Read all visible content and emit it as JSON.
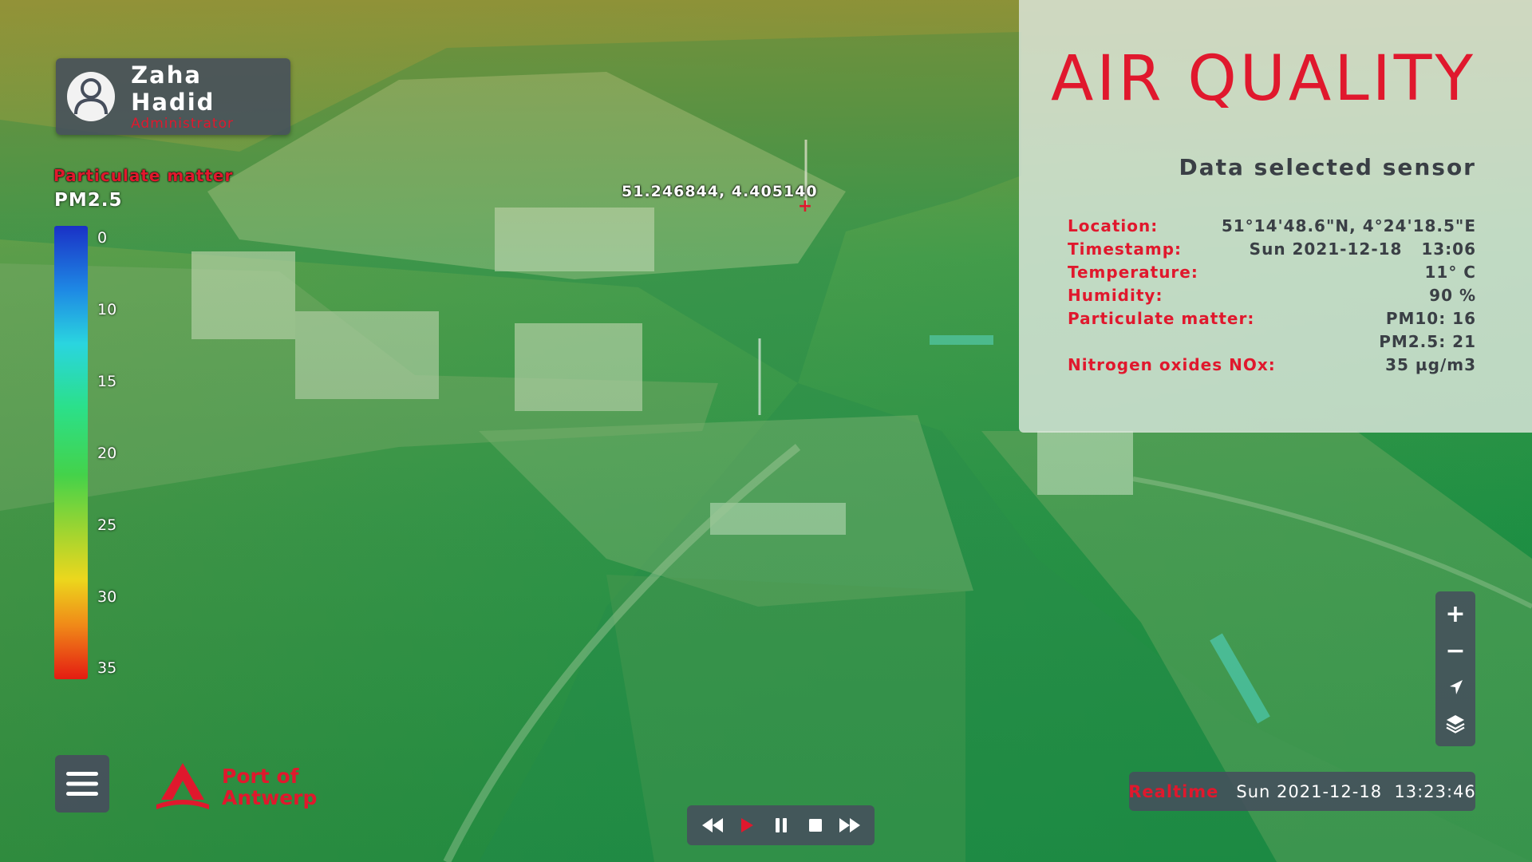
{
  "user": {
    "name": "Zaha Hadid",
    "role": "Administrator"
  },
  "legend": {
    "title": "Particulate matter",
    "pollutant": "PM2.5",
    "ticks": [
      "0",
      "10",
      "15",
      "20",
      "25",
      "30",
      "35"
    ],
    "colors": [
      "#1a31c6",
      "#1e88e4",
      "#2ad5df",
      "#2be08a",
      "#44d24a",
      "#a4d52f",
      "#ecd71d",
      "#f08a18",
      "#e41c12"
    ]
  },
  "map": {
    "marker_coords": "51.246844, 4.405140",
    "marker_icon": "crosshair-plus-icon"
  },
  "panel": {
    "title": "AIR QUALITY",
    "subtitle": "Data selected sensor",
    "rows": [
      {
        "label": "Location:",
        "value": "51°14'48.6\"N, 4°24'18.5\"E"
      },
      {
        "label": "Timestamp:",
        "value": "Sun 2021-12-18   13:06"
      },
      {
        "label": "Temperature:",
        "value": "11° C"
      },
      {
        "label": "Humidity:",
        "value": "90 %"
      },
      {
        "label": "Particulate matter:",
        "value": "PM10: 16"
      },
      {
        "label": "",
        "value": "PM2.5: 21"
      },
      {
        "label": "Nitrogen oxides NOx:",
        "value": "35 µg/m3"
      }
    ]
  },
  "map_controls": [
    {
      "name": "zoom-in-icon",
      "glyph": "+"
    },
    {
      "name": "zoom-out-icon",
      "glyph": "−"
    },
    {
      "name": "navigate-arrow-icon",
      "glyph": ""
    },
    {
      "name": "layers-icon",
      "glyph": ""
    }
  ],
  "logo": {
    "line1": "Port of",
    "line2": "Antwerp"
  },
  "playback": [
    "rewind-icon",
    "play-icon",
    "pause-icon",
    "stop-icon",
    "fast-forward-icon"
  ],
  "realtime": {
    "label": "Realtime",
    "datetime": "Sun 2021-12-18  13:23:46"
  },
  "colors": {
    "accent": "#e0182d",
    "panel_bg": "#dee8de",
    "control_bg": "#464e5c"
  }
}
